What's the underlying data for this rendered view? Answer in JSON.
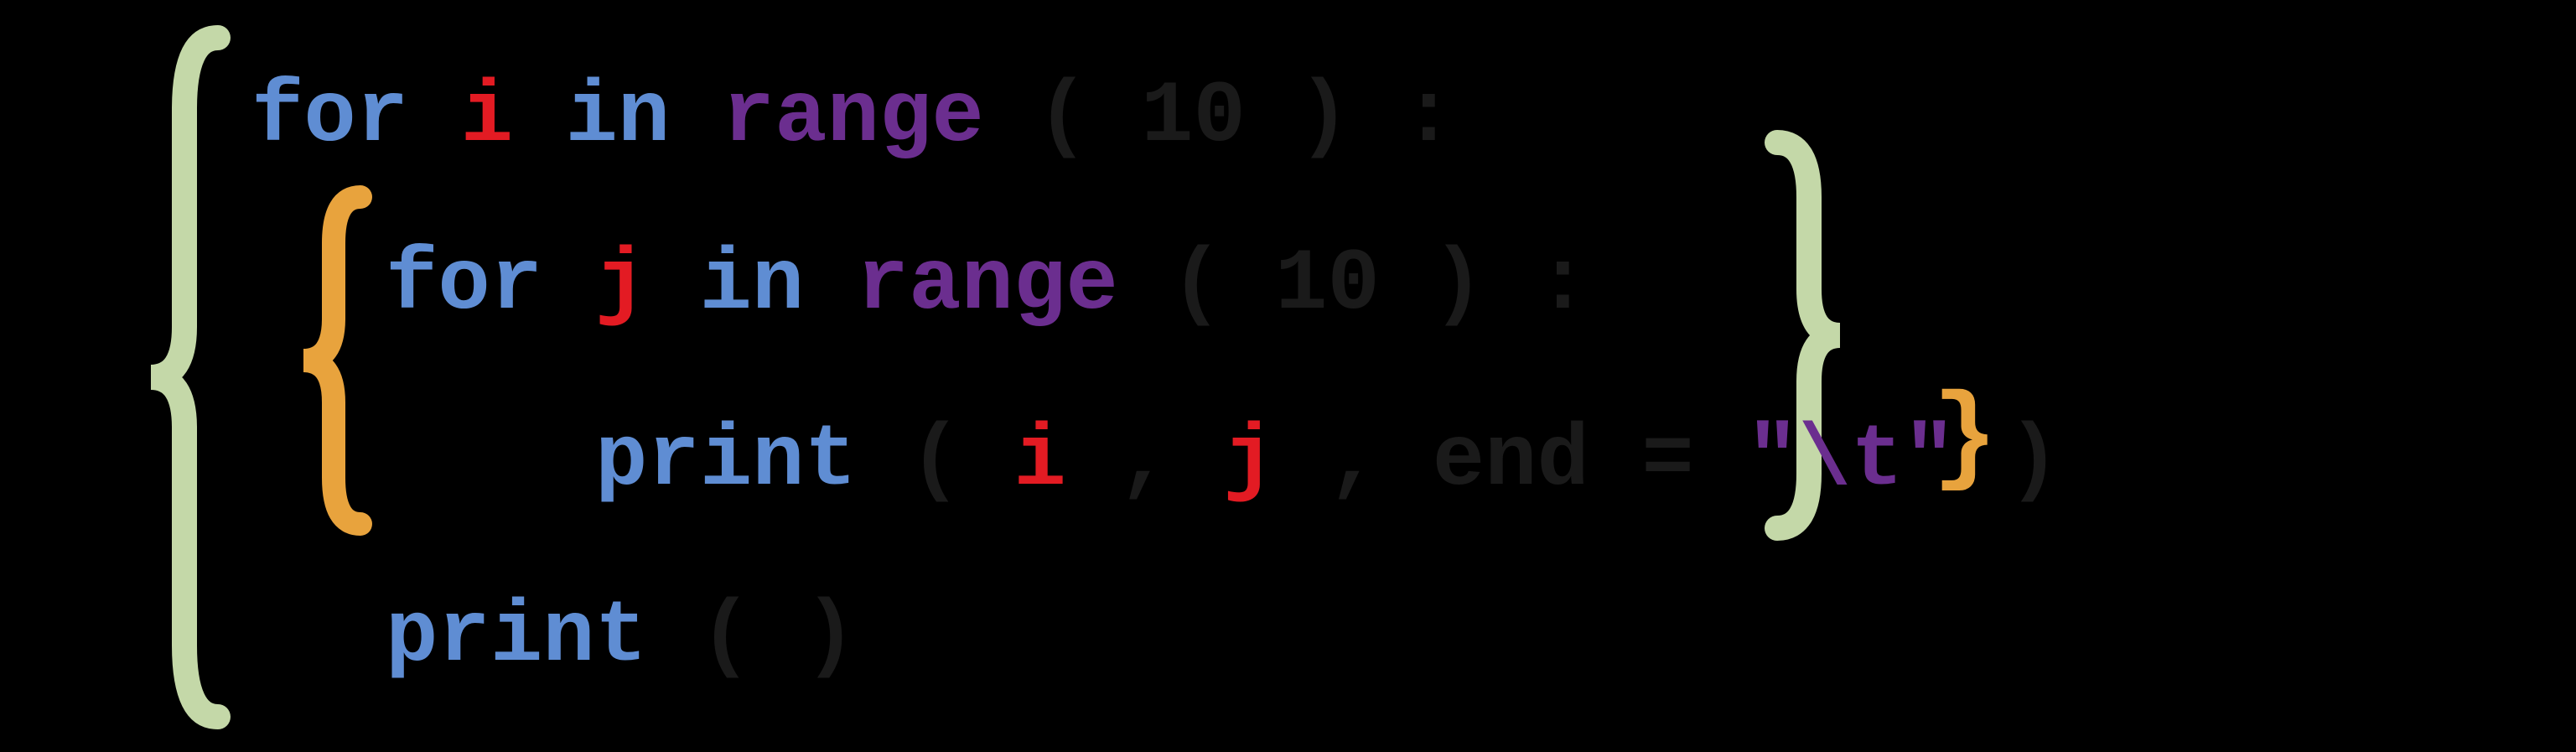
{
  "code": {
    "line1": {
      "for": "for",
      "var": "i",
      "in": "in",
      "range": "range",
      "open": "(",
      "arg": "10",
      "close": ")",
      "colon": ":"
    },
    "line2": {
      "for": "for",
      "var": "j",
      "in": "in",
      "range": "range",
      "open": "(",
      "arg": "10",
      "close": ")",
      "colon": ":"
    },
    "line3": {
      "print": "print",
      "open": "(",
      "var1": "i",
      "comma1": ",",
      "var2": "j",
      "comma2": ",",
      "kw": "end",
      "eq": "=",
      "str": "\"\\t\"",
      "close": ")",
      "brace": "}"
    },
    "line4": {
      "print": "print",
      "open": "(",
      "close": ")"
    }
  },
  "colors": {
    "outer_brace": "#c4d8a8",
    "inner_brace": "#e8a33d",
    "keyword": "#5f8dd3",
    "function": "#6b2e8f",
    "variable": "#e31b23",
    "string": "#6b2e8f"
  }
}
